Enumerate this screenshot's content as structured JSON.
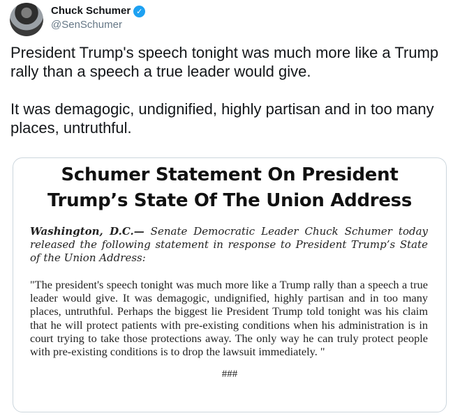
{
  "tweet": {
    "author": {
      "display_name": "Chuck Schumer",
      "handle": "@SenSchumer",
      "verified_icon": "✓"
    },
    "text_paragraphs": [
      "President Trump's speech tonight was much more like a Trump rally than a speech a true leader would give.",
      "It was demagogic, undignified, highly partisan and in too many places, untruthful."
    ]
  },
  "statement_card": {
    "title_line1": "Schumer Statement On President",
    "title_line2": "Trump’s State Of The Union Address",
    "dateline": "Washington, D.C.—",
    "lead": " Senate Democratic Leader Chuck Schumer today released the following statement in response to President Trump’s State of the Union Address:",
    "quote": "\"The president's speech tonight was much more like a Trump rally than a speech a true leader would give. It was demagogic, undignified, highly partisan and in too many places, untruthful. Perhaps the biggest lie President Trump told tonight was his claim that he will protect patients with pre-existing conditions when his administration is in court trying to take those protections away. The only way he can truly protect people with pre-existing conditions is to drop the lawsuit immediately. \"",
    "end_mark": "###"
  },
  "colors": {
    "verified_blue": "#1da1f2",
    "handle_gray": "#657786",
    "card_border": "#ccd6dd"
  }
}
